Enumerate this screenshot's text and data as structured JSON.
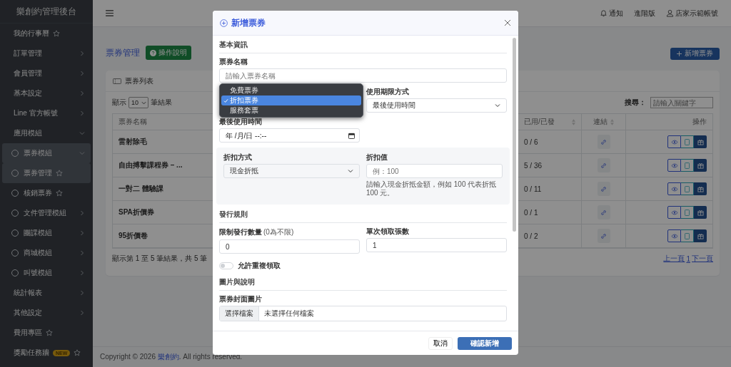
{
  "sidebar": {
    "brand": "樂創約管理後台",
    "items": [
      {
        "label": "我的行事曆",
        "kind": "link",
        "selected": false
      },
      {
        "label": "訂單管理",
        "kind": "group",
        "expanded": false
      },
      {
        "label": "會員管理",
        "kind": "group",
        "expanded": false
      },
      {
        "label": "基本設定",
        "kind": "group",
        "expanded": false
      },
      {
        "label": "Line 官方帳號",
        "kind": "group",
        "expanded": false
      },
      {
        "label": "應用模組",
        "kind": "group",
        "expanded": true,
        "children": [
          {
            "label": "票券模組",
            "kind": "group",
            "expanded": true,
            "children": [
              {
                "label": "票券管理",
                "kind": "link",
                "selected": true
              },
              {
                "label": "核銷票券",
                "kind": "link",
                "selected": false
              }
            ]
          },
          {
            "label": "文件管理模組",
            "kind": "group",
            "expanded": false
          },
          {
            "label": "團課模組",
            "kind": "group",
            "expanded": false
          },
          {
            "label": "商城模組",
            "kind": "group",
            "expanded": false
          },
          {
            "label": "叫號模組",
            "kind": "group",
            "expanded": false
          }
        ]
      },
      {
        "label": "統計報表",
        "kind": "group",
        "expanded": false
      },
      {
        "label": "其他設定",
        "kind": "group",
        "expanded": false
      },
      {
        "label": "費用專區",
        "kind": "link",
        "selected": false
      },
      {
        "label": "獎勵任務牆",
        "kind": "link",
        "selected": false,
        "badge": "NEW"
      }
    ]
  },
  "header": {
    "links": [
      {
        "label": "通知",
        "kind": "bell"
      },
      {
        "label": "進階版",
        "kind": "plain"
      },
      {
        "label": "店家示範帳號",
        "kind": "user"
      }
    ]
  },
  "page": {
    "title": "票券管理",
    "help_button": "操作說明",
    "add_button": "新增票券"
  },
  "card": {
    "title": "票券列表",
    "length": {
      "prefix": "顯示",
      "value": "10",
      "suffix": "筆結果"
    },
    "search": {
      "label": "搜尋：",
      "placeholder": "請輸入關鍵字"
    },
    "table": {
      "columns": [
        {
          "label": "票券名稱",
          "sortable": false
        },
        {
          "label": "已用/已發",
          "sortable": true
        },
        {
          "label": "連結",
          "sortable": true
        },
        {
          "label": "操作",
          "sortable": false
        }
      ],
      "rows": [
        {
          "name": "雷射除毛",
          "used": "0 / 6"
        },
        {
          "name": "自由搏擊課程券 – ...",
          "used": "5 / 36"
        },
        {
          "name": "一對二 體驗課",
          "used": "0 / 11"
        },
        {
          "name": "SPA折價券",
          "used": "0 / 1"
        },
        {
          "name": "95折價卷",
          "used": "0 / 2"
        }
      ]
    },
    "info": "顯示第 1 至 5 筆結果，共 5 筆",
    "pagination": [
      "上一頁",
      "1",
      "下一頁"
    ]
  },
  "footer": {
    "before": "Copyright © 2026 ",
    "link": "樂創約",
    "after": ". All rights reserved."
  },
  "modal": {
    "title": "新增票券",
    "basic": {
      "heading": "基本資訊",
      "name_field": {
        "label": "票券名稱",
        "placeholder": "請輸入票券名稱"
      },
      "type_select": {
        "options": [
          {
            "label": "免費票券",
            "selected": false
          },
          {
            "label": "折扣票券",
            "selected": true
          },
          {
            "label": "服務套票",
            "selected": false
          }
        ]
      },
      "expiry_mode": {
        "label": "使用期限方式",
        "value": "最後使用時間"
      },
      "expiry_date": {
        "label": "最後使用時間",
        "placeholder": "年 /月/日 --:--"
      },
      "discount": {
        "method": {
          "label": "折扣方式",
          "value": "現金折抵"
        },
        "amount": {
          "label": "折扣值",
          "placeholder": "例：100",
          "help": "請輸入現金折抵金額，例如 100 代表折抵 100 元。"
        }
      }
    },
    "issue": {
      "heading": "發行規則",
      "limit": {
        "label": "限制發行數量",
        "hint": "(0為不限)",
        "value": "0"
      },
      "per_claim": {
        "label": "單次領取張數",
        "value": "1"
      },
      "repeat": {
        "label": "允許重複領取",
        "on": false
      }
    },
    "media": {
      "heading": "圖片與說明",
      "cover": {
        "label": "票券封面圖片",
        "button": "選擇檔案",
        "status": "未選擇任何檔案"
      }
    },
    "buttons": {
      "cancel": "取消",
      "confirm": "確認新增"
    }
  }
}
